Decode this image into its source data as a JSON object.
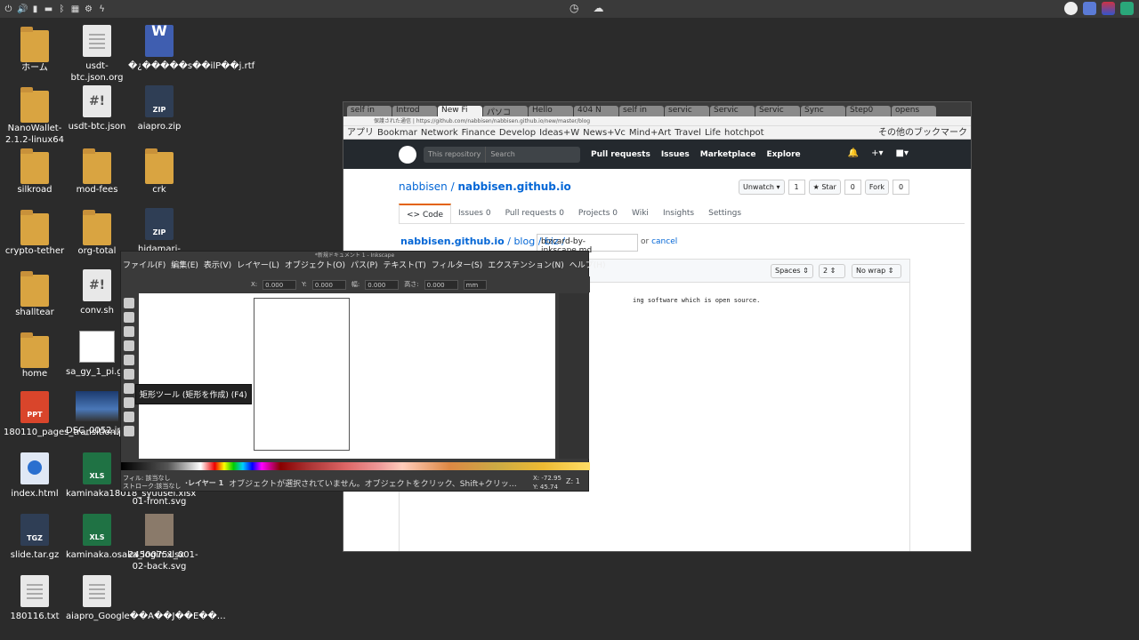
{
  "topbar": {
    "left_icons": [
      "power-icon",
      "volume-icon",
      "network-icon",
      "battery-icon",
      "bluetooth-icon",
      "drive-icon",
      "gear-icon",
      "lightning-icon"
    ]
  },
  "desktop": [
    {
      "label": "ホーム",
      "type": "folder"
    },
    {
      "label": "usdt-btc.json.org",
      "type": "doc"
    },
    {
      "label": "\u0000s\u0000ilP\u0000j.rtf",
      "type": "rtf",
      "display": "�¿�����s��ilP��j.rtf"
    },
    {
      "label": "NanoWallet-2.1.2-linux64",
      "type": "folder"
    },
    {
      "label": "usdt-btc.json",
      "type": "sh"
    },
    {
      "label": "aiapro.zip",
      "type": "zip"
    },
    {
      "label": "silkroad",
      "type": "folder"
    },
    {
      "label": "mod-fees",
      "type": "folder"
    },
    {
      "label": "crk",
      "type": "folder"
    },
    {
      "label": "crypto-tether",
      "type": "folder"
    },
    {
      "label": "org-total",
      "type": "folder"
    },
    {
      "label": "hidamari-",
      "type": "zip"
    },
    {
      "label": "shalltear",
      "type": "folder"
    },
    {
      "label": "conv.sh",
      "type": "sh"
    },
    {
      "label": "home",
      "type": "folder"
    },
    {
      "label": "sa_gy_1_pi.gpng",
      "type": "img"
    },
    {
      "label": "180110_pages_transition.p…",
      "type": "ppt"
    },
    {
      "label": "DSC_0052.jpg",
      "type": "dsc"
    },
    {
      "label": "index.html",
      "type": "html"
    },
    {
      "label": "kaminaka18018_syuusei.xlsx",
      "type": "xls"
    },
    {
      "label": "01-front.svg",
      "type": "none"
    },
    {
      "label": "slide.tar.gz",
      "type": "zip"
    },
    {
      "label": "kaminaka.osaka_login.xlsx",
      "type": "xls"
    },
    {
      "label": "24500751_001-02-back.svg",
      "type": "svg"
    },
    {
      "label": "180116.txt",
      "type": "doc"
    },
    {
      "label": "aiapro_Google��A��J��E��…",
      "type": "doc"
    }
  ],
  "chrome": {
    "tabs": [
      "self in",
      "Introd",
      "New Fi",
      "パソコ",
      "Hello",
      "404 N",
      "self in",
      "servic",
      "Servic",
      "Servic",
      "Sync",
      "Step0",
      "opens"
    ],
    "active_tab": 2,
    "url": "保護された通信 | https://github.com/nabbisen/nabbisen.github.io/new/master/blog",
    "bookmarks": [
      "アプリ",
      "Bookmar",
      "Network",
      "Finance",
      "Develop",
      "Ideas+W",
      "News+Vc",
      "Mind+Art",
      "Travel",
      "Life",
      "hotchpot"
    ],
    "bookmarks_more": "その他のブックマーク",
    "gh_search_scope": "This repository",
    "gh_search_placeholder": "Search",
    "gh_nav": [
      "Pull requests",
      "Issues",
      "Marketplace",
      "Explore"
    ],
    "repo_owner": "nabbisen",
    "repo_sep": " / ",
    "repo_name": "nabbisen.github.io",
    "unwatch": "Unwatch ▾",
    "unwatch_count": "1",
    "star": "★ Star",
    "star_count": "0",
    "fork": "Fork",
    "fork_count": "0",
    "repo_tabs": [
      {
        "label": "<> Code"
      },
      {
        "label": "Issues",
        "count": "0"
      },
      {
        "label": "Pull requests",
        "count": "0"
      },
      {
        "label": "Projects",
        "count": "0"
      },
      {
        "label": "Wiki"
      },
      {
        "label": "Insights"
      },
      {
        "label": "Settings"
      }
    ],
    "breadcrumb_repo": "nabbisen.github.io",
    "breadcrumb_rest": " / blog / biz /",
    "filename": "bizcard-by-inkscape.md",
    "or_text": "or",
    "cancel": "cancel",
    "indent_mode": "Spaces",
    "indent_size": "2",
    "wrap_mode": "No wrap",
    "code_line": "ing software which is open source."
  },
  "inkscape": {
    "title": "*新規ドキュメント 1 - Inkscape",
    "menu": [
      "ファイル(F)",
      "編集(E)",
      "表示(V)",
      "レイヤー(L)",
      "オブジェクト(O)",
      "パス(P)",
      "テキスト(T)",
      "フィルター(S)",
      "エクステンション(N)",
      "ヘルプ(H)"
    ],
    "x_label": "X:",
    "x_value": "0.000",
    "y_label": "Y:",
    "y_value": "0.000",
    "w_label": "幅:",
    "w_value": "0.000",
    "h_label": "高さ:",
    "h_value": "0.000",
    "unit": "mm",
    "fill_label": "フィル:",
    "fill_value": "該当なし",
    "stroke_label": "ストローク:",
    "stroke_value": "該当なし",
    "layer": "·レイヤー 1",
    "status": "オブジェクトが選択されていません。オブジェクトをクリック、Shift+クリッ…",
    "coord_x": "X: -72.95",
    "coord_y": "Y:  45.74",
    "zoom_label": "Z:",
    "zoom_value": "1",
    "tooltip": "矩形ツール (矩形を作成) (F4)"
  }
}
